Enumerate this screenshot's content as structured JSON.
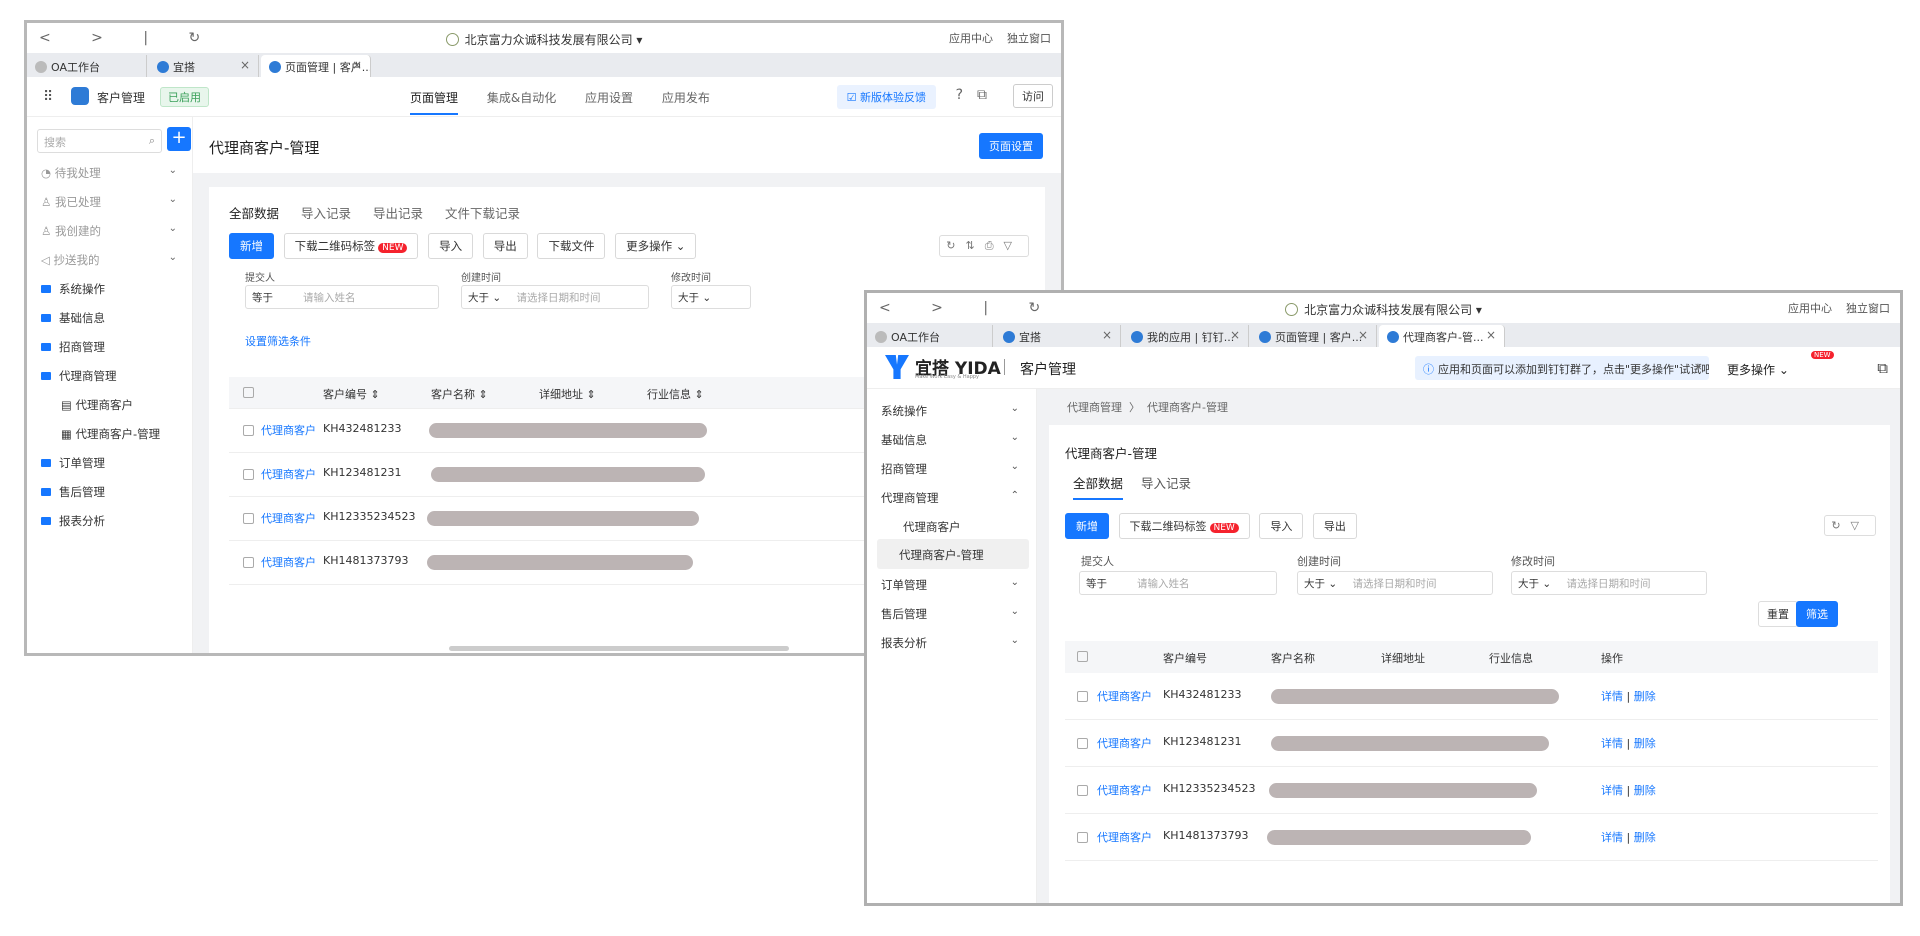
{
  "w1": {
    "company": "北京富力众诚科技发展有限公司",
    "app_center": "应用中心",
    "standalone": "独立窗口",
    "tabs": [
      {
        "label": "OA工作台"
      },
      {
        "label": "宜搭"
      },
      {
        "label": "页面管理 | 客户..."
      }
    ],
    "app_title": "客户管理",
    "app_status": "已启用",
    "topnav": [
      "页面管理",
      "集成&自动化",
      "应用设置",
      "应用发布"
    ],
    "feedback": "新版体验反馈",
    "visit": "访问",
    "search_placeholder": "搜索",
    "sidebar": [
      {
        "label": "待我处理",
        "type": "gray"
      },
      {
        "label": "我已处理",
        "type": "gray"
      },
      {
        "label": "我创建的",
        "type": "gray"
      },
      {
        "label": "抄送我的",
        "type": "gray"
      },
      {
        "label": "系统操作",
        "type": "folder"
      },
      {
        "label": "基础信息",
        "type": "folder"
      },
      {
        "label": "招商管理",
        "type": "folder"
      },
      {
        "label": "代理商管理",
        "type": "folder"
      },
      {
        "label": "代理商客户",
        "type": "page"
      },
      {
        "label": "代理商客户-管理",
        "type": "page"
      },
      {
        "label": "订单管理",
        "type": "folder"
      },
      {
        "label": "售后管理",
        "type": "folder"
      },
      {
        "label": "报表分析",
        "type": "folder"
      }
    ],
    "page_title": "代理商客户-管理",
    "page_settings": "页面设置",
    "data_tabs": [
      "全部数据",
      "导入记录",
      "导出记录",
      "文件下载记录"
    ],
    "buttons": {
      "add": "新增",
      "qr": "下载二维码标签",
      "new_badge": "NEW",
      "import": "导入",
      "export": "导出",
      "download": "下载文件",
      "more": "更多操作"
    },
    "filters": {
      "submitter_label": "提交人",
      "submitter_op": "等于",
      "submitter_ph": "请输入姓名",
      "created_label": "创建时间",
      "created_op": "大于",
      "created_ph": "请选择日期和时间",
      "modified_label": "修改时间",
      "modified_op": "大于"
    },
    "set_filter": "设置筛选条件",
    "columns": [
      "客户编号",
      "客户名称",
      "详细地址",
      "行业信息"
    ],
    "rows": [
      {
        "type": "代理商客户",
        "id": "KH432481233"
      },
      {
        "type": "代理商客户",
        "id": "KH123481231"
      },
      {
        "type": "代理商客户",
        "id": "KH12335234523"
      },
      {
        "type": "代理商客户",
        "id": "KH1481373793"
      }
    ]
  },
  "w2": {
    "company": "北京富力众诚科技发展有限公司",
    "app_center": "应用中心",
    "standalone": "独立窗口",
    "tabs": [
      {
        "label": "OA工作台"
      },
      {
        "label": "宜搭"
      },
      {
        "label": "我的应用 | 钉钉..."
      },
      {
        "label": "页面管理 | 客户..."
      },
      {
        "label": "代理商客户-管..."
      }
    ],
    "brand": "宜搭 YIDA",
    "brand_sub": "Make Work Easy & Happy",
    "app_title": "客户管理",
    "notice": "应用和页面可以添加到钉钉群了，点击\"更多操作\"试试吧",
    "more_ops": "更多操作",
    "new_badge": "NEW",
    "sidebar": [
      {
        "label": "系统操作",
        "chev": "⌄"
      },
      {
        "label": "基础信息",
        "chev": "⌄"
      },
      {
        "label": "招商管理",
        "chev": "⌄"
      },
      {
        "label": "代理商管理",
        "chev": "⌃"
      },
      {
        "label": "代理商客户",
        "chev": ""
      },
      {
        "label": "代理商客户-管理",
        "chev": ""
      },
      {
        "label": "订单管理",
        "chev": "⌄"
      },
      {
        "label": "售后管理",
        "chev": "⌄"
      },
      {
        "label": "报表分析",
        "chev": "⌄"
      }
    ],
    "breadcrumb": [
      "代理商管理",
      "代理商客户-管理"
    ],
    "page_title": "代理商客户-管理",
    "data_tabs": [
      "全部数据",
      "导入记录"
    ],
    "buttons": {
      "add": "新增",
      "qr": "下载二维码标签",
      "new_badge": "NEW",
      "import": "导入",
      "export": "导出"
    },
    "filters": {
      "submitter_label": "提交人",
      "submitter_op": "等于",
      "submitter_ph": "请输入姓名",
      "created_label": "创建时间",
      "created_op": "大于",
      "created_ph": "请选择日期和时间",
      "modified_label": "修改时间",
      "modified_op": "大于",
      "modified_ph": "请选择日期和时间"
    },
    "reset": "重置",
    "filter": "筛选",
    "columns": [
      "客户编号",
      "客户名称",
      "详细地址",
      "行业信息",
      "操作"
    ],
    "rows": [
      {
        "type": "代理商客户",
        "id": "KH432481233"
      },
      {
        "type": "代理商客户",
        "id": "KH123481231"
      },
      {
        "type": "代理商客户",
        "id": "KH12335234523"
      },
      {
        "type": "代理商客户",
        "id": "KH1481373793"
      }
    ],
    "op_detail": "详情",
    "op_delete": "删除"
  }
}
